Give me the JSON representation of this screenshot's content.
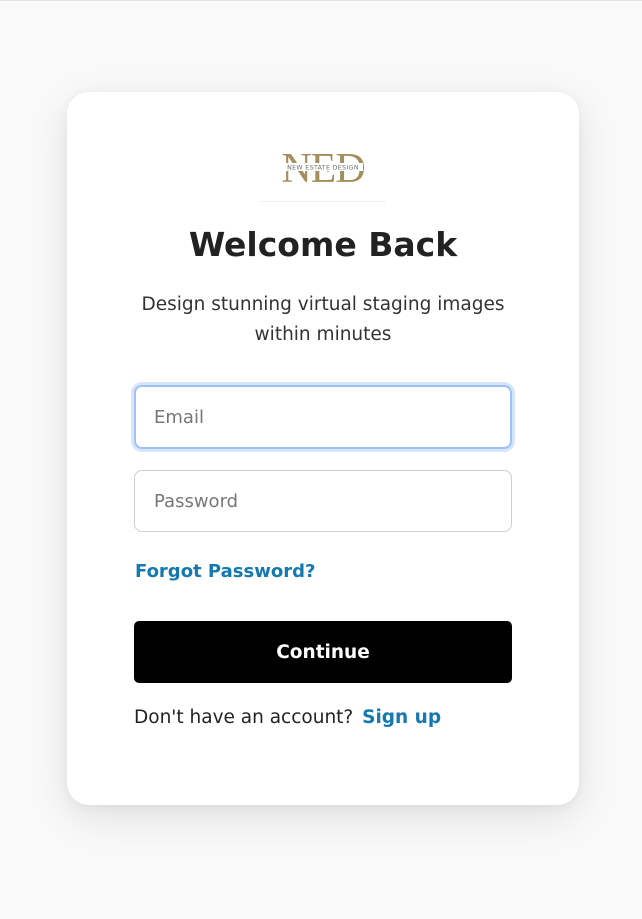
{
  "brand": {
    "logo_letters": "NED",
    "logo_tagline": "NEW ESTATE DESIGN",
    "logo_color": "#a38f5e"
  },
  "login": {
    "title": "Welcome Back",
    "subtitle": "Design stunning virtual staging images within minutes",
    "email": {
      "placeholder": "Email",
      "value": ""
    },
    "password": {
      "placeholder": "Password",
      "value": ""
    },
    "forgot_label": "Forgot Password?",
    "continue_label": "Continue",
    "signup_prompt": "Don't have an account?",
    "signup_label": "Sign up"
  },
  "colors": {
    "link": "#1479b0",
    "button_bg": "#000000",
    "focus_ring": "#9ec2f5"
  }
}
